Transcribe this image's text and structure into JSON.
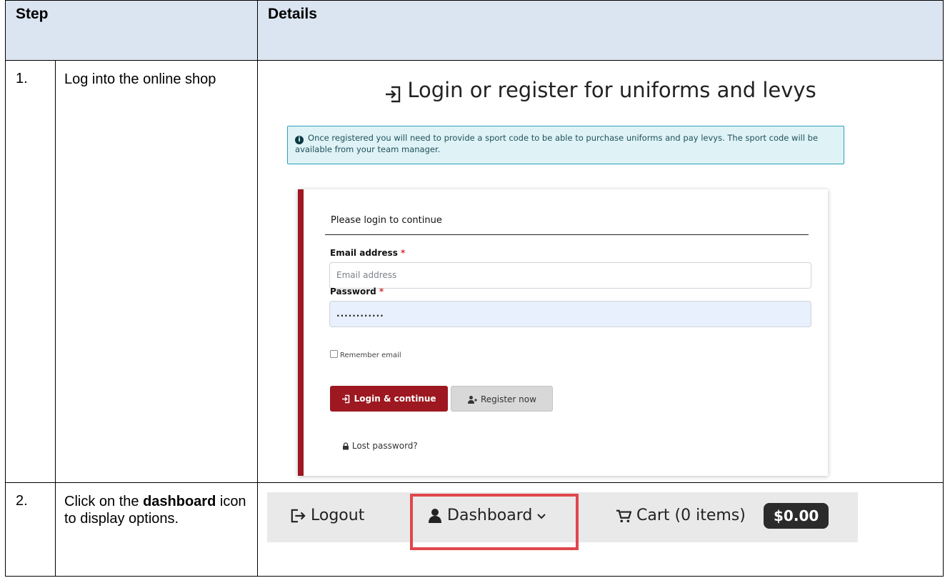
{
  "table": {
    "header_step": "Step",
    "header_details": "Details"
  },
  "steps": [
    {
      "number": "1.",
      "description": "Log into the online shop"
    },
    {
      "number": "2.",
      "description_prefix": "Click on the ",
      "description_bold": "dashboard",
      "description_suffix": " icon to display options."
    }
  ],
  "login": {
    "title": "Login or register for uniforms and levys",
    "info_text": "Once registered you will need to provide a sport code to be able to purchase uniforms and pay levys. The sport code will be available from your team manager.",
    "card_heading": "Please login to continue",
    "email_label": "Email address",
    "required_mark": "*",
    "email_placeholder": "Email address",
    "password_label": "Password",
    "password_value": "............",
    "remember_label": "Remember email",
    "login_button": "Login & continue",
    "register_button": "Register now",
    "lost_password": "Lost password?",
    "accent_color": "#9d1820"
  },
  "navbar": {
    "logout": "Logout",
    "dashboard": "Dashboard",
    "cart": "Cart (0 items)",
    "cart_total": "$0.00",
    "highlight_color": "#e0474c"
  }
}
